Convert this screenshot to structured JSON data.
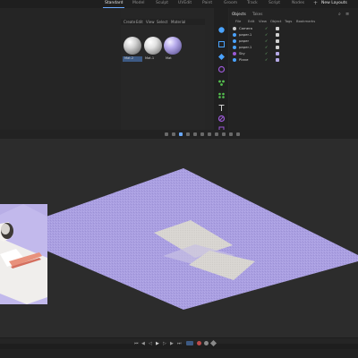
{
  "layout_tabs": [
    "Standard",
    "Model",
    "Sculpt",
    "UVEdit",
    "Paint",
    "Groom",
    "Track",
    "Script",
    "Nodes"
  ],
  "active_layout_tab": "Standard",
  "new_layouts_label": "New Layouts",
  "material_manager": {
    "menu": [
      "Create",
      "Edit",
      "View",
      "Select",
      "Material"
    ],
    "materials": [
      {
        "label": "Mat.2",
        "color": "#c9c9c9"
      },
      {
        "label": "Mat.1",
        "color": "#dcdcdc"
      },
      {
        "label": "Mat",
        "color": "#b4a8e6"
      }
    ]
  },
  "object_manager": {
    "tabs": [
      "Objects",
      "Takes"
    ],
    "menu": [
      "File",
      "Edit",
      "View",
      "Object",
      "Tags",
      "Bookmarks"
    ],
    "objects": [
      {
        "name": "Camera",
        "tag_color": "#d0d0d0"
      },
      {
        "name": "paper.1",
        "tag_color": "#d0d0d0"
      },
      {
        "name": "paper",
        "tag_color": "#d0d0d0"
      },
      {
        "name": "paper.1",
        "tag_color": "#d0d0d0"
      },
      {
        "name": "Sky",
        "tag_color": "#b4a8e6"
      },
      {
        "name": "Plane",
        "tag_color": "#b4a8e6"
      }
    ]
  },
  "colors": {
    "plane": "#a99ee0",
    "paper": "#dad7d3",
    "accent": "#6aa9ff"
  }
}
